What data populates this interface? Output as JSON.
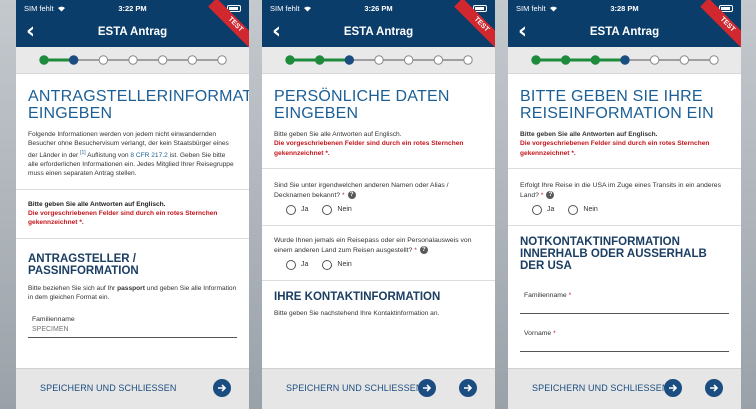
{
  "status": {
    "carrier": "SIM fehlt",
    "screens": [
      {
        "time": "3:22 PM"
      },
      {
        "time": "3:26 PM"
      },
      {
        "time": "3:28 PM"
      }
    ]
  },
  "nav": {
    "title": "ESTA Antrag",
    "ribbon": "TEST",
    "back_glyph": "‹"
  },
  "progress": {
    "steps_total": 7,
    "screens": [
      {
        "completed": 1,
        "current": 2
      },
      {
        "completed": 2,
        "current": 3
      },
      {
        "completed": 3,
        "current": 4
      }
    ],
    "colors": {
      "done": "#1e8a3c",
      "current": "#1b4d80",
      "todo": "#ffffff"
    }
  },
  "screen1": {
    "title": "ANTRAGSTELLERINFORMATION EINGEBEN",
    "intro_a": "Folgende Informationen werden von jedem nicht einwandernden Besucher ohne Besuchervisum verlangt, der kein Staatsbürger eines der Länder in der",
    "intro_sup": "[1]",
    "intro_b": "Auflistung von",
    "intro_link": "8 CFR 217.2",
    "intro_c": "ist. Geben Sie bitte alle erforderlichen Informationen ein. Jedes Mitglied Ihrer Reisegruppe muss einen separaten Antrag stellen.",
    "english": "Bitte geben Sie alle Antworten auf Englisch.",
    "required": "Die vorgeschriebenen Felder sind durch ein rotes Sternchen gekennzeichnet",
    "required_star": "*",
    "required_dot": ".",
    "section": "ANTRAGSTELLER / PASSINFORMATION",
    "section_text_a": "Bitte beziehen Sie sich auf Ihr",
    "section_text_bold": "passport",
    "section_text_b": "und geben Sie alle Information in dem gleichen Format ein.",
    "field_label": "Familienname",
    "field_placeholder": "SPECIMEN"
  },
  "screen2": {
    "title": "PERSÖNLICHE DATEN EINGEBEN",
    "english": "Bitte geben Sie alle Antworten auf Englisch.",
    "required": "Die vorgeschriebenen Felder sind durch ein rotes Sternchen gekennzeichnet",
    "required_star": "*",
    "required_dot": ".",
    "q1": "Sind Sie unter irgendwelchen anderen Namen oder Alias / Decknamen bekannt?",
    "q2": "Wurde Ihnen jemals ein Reisepass oder ein Personalausweis von einem anderen Land zum Reisen ausgestellt?",
    "yes": "Ja",
    "no": "Nein",
    "section": "IHRE KONTAKTINFORMATION",
    "section_text": "Bitte geben Sie nachstehend Ihre Kontaktinformation an."
  },
  "screen3": {
    "title": "BITTE GEBEN SIE IHRE REISEINFORMATION EIN",
    "english": "Bitte geben Sie alle Antworten auf Englisch.",
    "required": "Die vorgeschriebenen Felder sind durch ein rotes Sternchen gekennzeichnet",
    "required_star": "*",
    "required_dot": ".",
    "q1": "Erfolgt Ihre Reise in die USA im Zuge eines Transits in ein anderes Land?",
    "yes": "Ja",
    "no": "Nein",
    "section": "NOTKONTAKTINFORMATION INNERHALB ODER AUSSERHALB DER USA",
    "field1_label": "Familienname",
    "field2_label": "Vorname"
  },
  "footer": {
    "save_label": "SPEICHERN UND SCHLIESSEN"
  },
  "icons": {
    "back": "chevron-left-icon",
    "next": "arrow-right-circle-icon",
    "help": "question-circle-icon",
    "wifi": "wifi-icon",
    "battery": "battery-icon"
  },
  "colors": {
    "nav": "#0b3d6b",
    "title": "#1b5f96",
    "required_text": "#c4161c",
    "ribbon": "#d0282e"
  }
}
